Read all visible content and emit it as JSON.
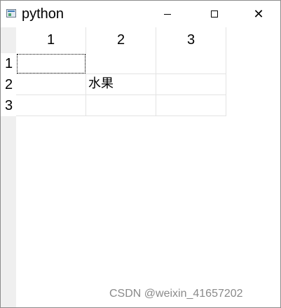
{
  "window": {
    "title": "python"
  },
  "table": {
    "col_headers": [
      "1",
      "2",
      "3"
    ],
    "row_headers": [
      "1",
      "2",
      "3"
    ],
    "cells": [
      [
        "",
        "",
        ""
      ],
      [
        "",
        "水果",
        ""
      ],
      [
        "",
        "",
        ""
      ]
    ]
  },
  "watermark": "CSDN @weixin_41657202"
}
